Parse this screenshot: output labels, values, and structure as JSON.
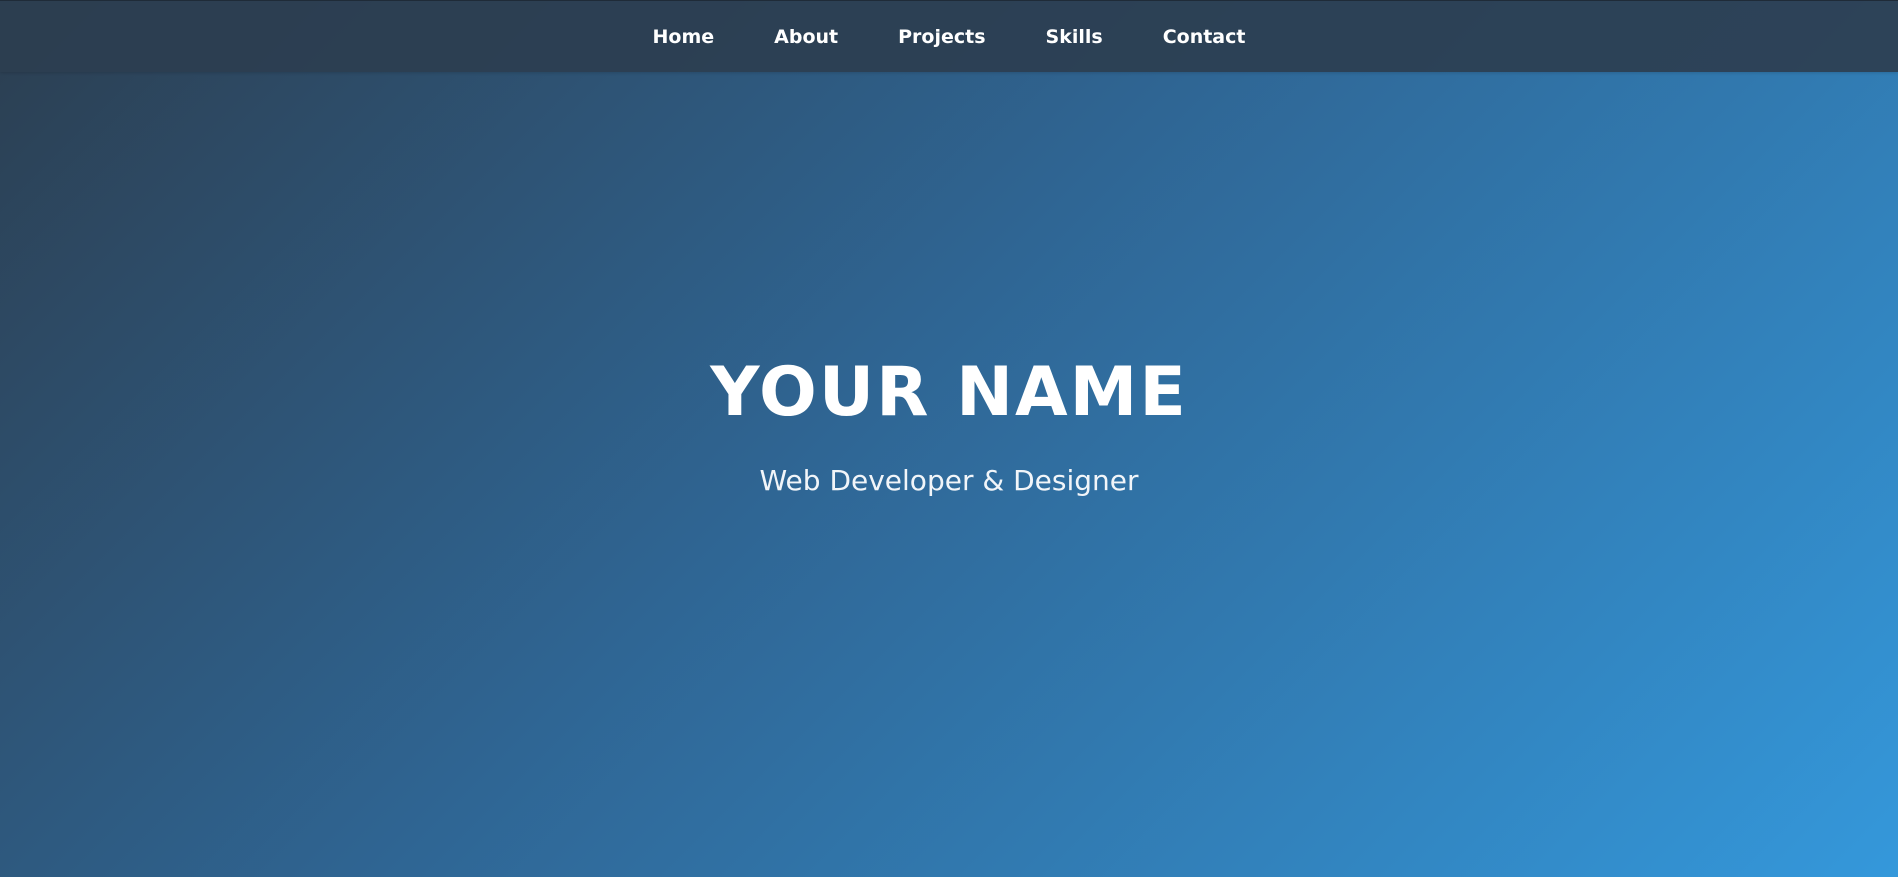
{
  "nav": {
    "items": [
      {
        "label": "Home"
      },
      {
        "label": "About"
      },
      {
        "label": "Projects"
      },
      {
        "label": "Skills"
      },
      {
        "label": "Contact"
      }
    ]
  },
  "hero": {
    "title": "YOUR NAME",
    "subtitle": "Web Developer & Designer"
  },
  "colors": {
    "nav_background": "#2c3e50",
    "gradient_start": "#2c3e50",
    "gradient_end": "#3498db",
    "text": "#ffffff"
  }
}
